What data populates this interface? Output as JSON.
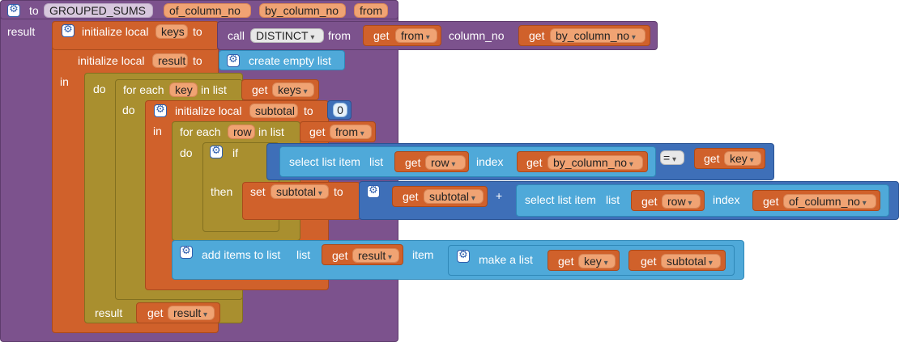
{
  "procedure": {
    "kw_to": "to",
    "name": "GROUPED_SUMS",
    "params": [
      "of_column_no",
      "by_column_no",
      "from"
    ],
    "kw_result": "result"
  },
  "keys_init": {
    "kw": "initialize local",
    "var": "keys",
    "kw_to": "to",
    "call_kw": "call",
    "call_fn": "DISTINCT",
    "arg1_label": "from",
    "get": "get",
    "arg1_var": "from",
    "arg2_label": "column_no",
    "arg2_var": "by_column_no"
  },
  "result_init": {
    "kw": "initialize local",
    "var": "result",
    "kw_to": "to",
    "value": "create empty list"
  },
  "kw_in": "in",
  "do_block": {
    "kw_do": "do",
    "kw_result": "result",
    "get": "get",
    "var": "result"
  },
  "foreach_key": {
    "kw": "for each",
    "var": "key",
    "kw_in_list": "in list",
    "get": "get",
    "list_var": "keys",
    "kw_do": "do"
  },
  "subtotal_init": {
    "kw": "initialize local",
    "var": "subtotal",
    "kw_to": "to",
    "value": "0",
    "kw_in": "in"
  },
  "foreach_row": {
    "kw": "for each",
    "var": "row",
    "kw_in_list": "in list",
    "get": "get",
    "list_var": "from",
    "kw_do": "do"
  },
  "if_block": {
    "kw_if": "if",
    "kw_then": "then"
  },
  "cond": {
    "select_kw": "select list item",
    "list_kw": "list",
    "get": "get",
    "list_var": "row",
    "index_kw": "index",
    "index_var": "by_column_no",
    "op": "=",
    "rhs_var": "key"
  },
  "set_block": {
    "kw_set": "set",
    "var": "subtotal",
    "kw_to": "to",
    "get": "get",
    "lhs_var": "subtotal",
    "plus": "+",
    "select_kw": "select list item",
    "list_kw": "list",
    "list_var": "row",
    "index_kw": "index",
    "index_var": "of_column_no"
  },
  "add_block": {
    "kw": "add items to list",
    "list_kw": "list",
    "get": "get",
    "list_var": "result",
    "item_kw": "item",
    "make_kw": "make a list",
    "item1_var": "key",
    "item2_var": "subtotal"
  },
  "colors": {
    "procedure": "#7c528d",
    "variables": "#d0612b",
    "control": "#a98f2f",
    "lists": "#4fa9d9",
    "math": "#3e6fb8"
  }
}
